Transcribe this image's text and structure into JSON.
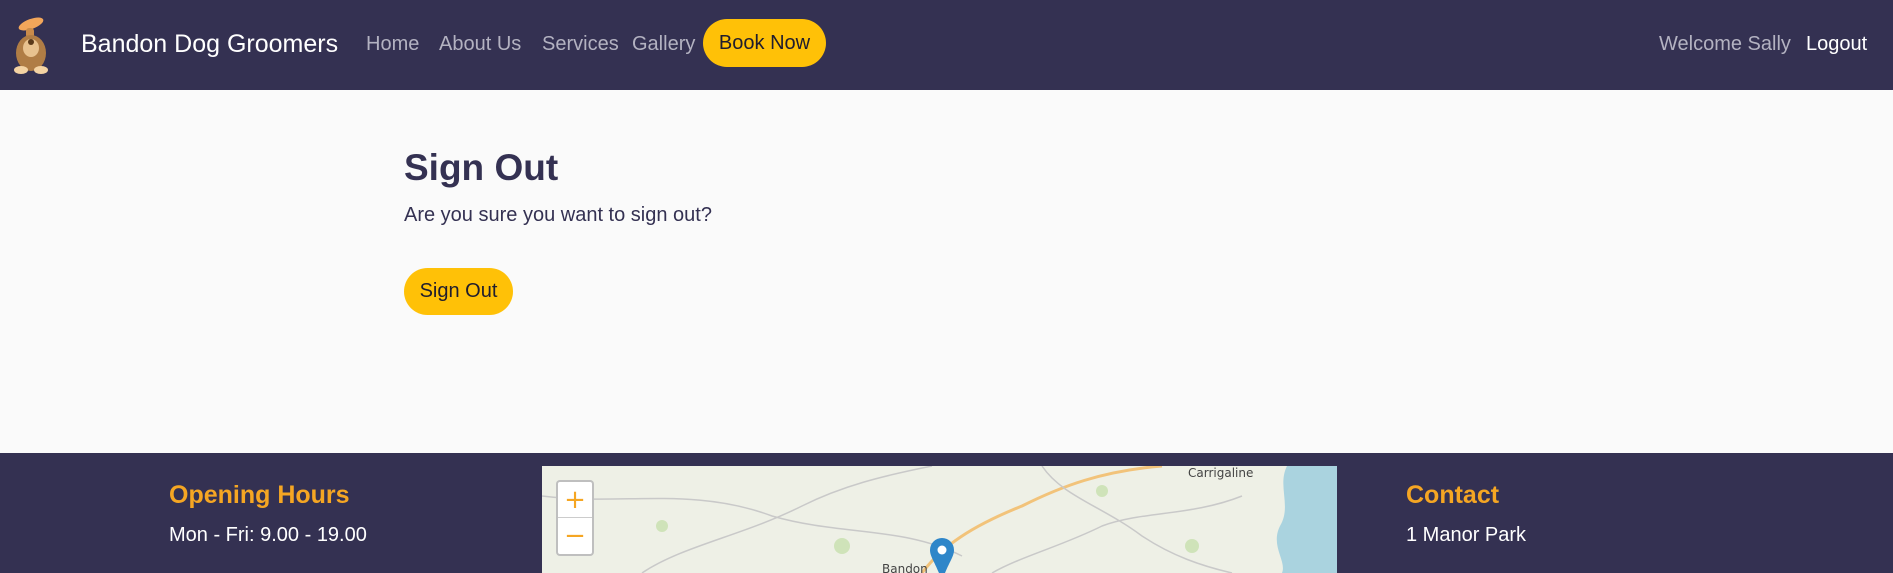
{
  "nav": {
    "brand": "Bandon Dog Groomers",
    "links": [
      "Home",
      "About Us",
      "Services",
      "Gallery"
    ],
    "book_label": "Book Now",
    "welcome": "Welcome Sally",
    "logout": "Logout"
  },
  "main": {
    "title": "Sign Out",
    "text": "Are you sure you want to sign out?",
    "button": "Sign Out"
  },
  "footer": {
    "hours": {
      "heading": "Opening Hours",
      "line": "Mon - Fri: 9.00 - 19.00"
    },
    "map": {
      "zoom_in": "+",
      "zoom_out": "−",
      "place_labels": [
        "Carrigaline",
        "Bandon"
      ]
    },
    "contact": {
      "heading": "Contact",
      "line": "1 Manor Park"
    }
  },
  "colors": {
    "navbar": "#343152",
    "accent": "#ffc107",
    "footer_heading": "#f5a623",
    "background": "#fafafa"
  }
}
